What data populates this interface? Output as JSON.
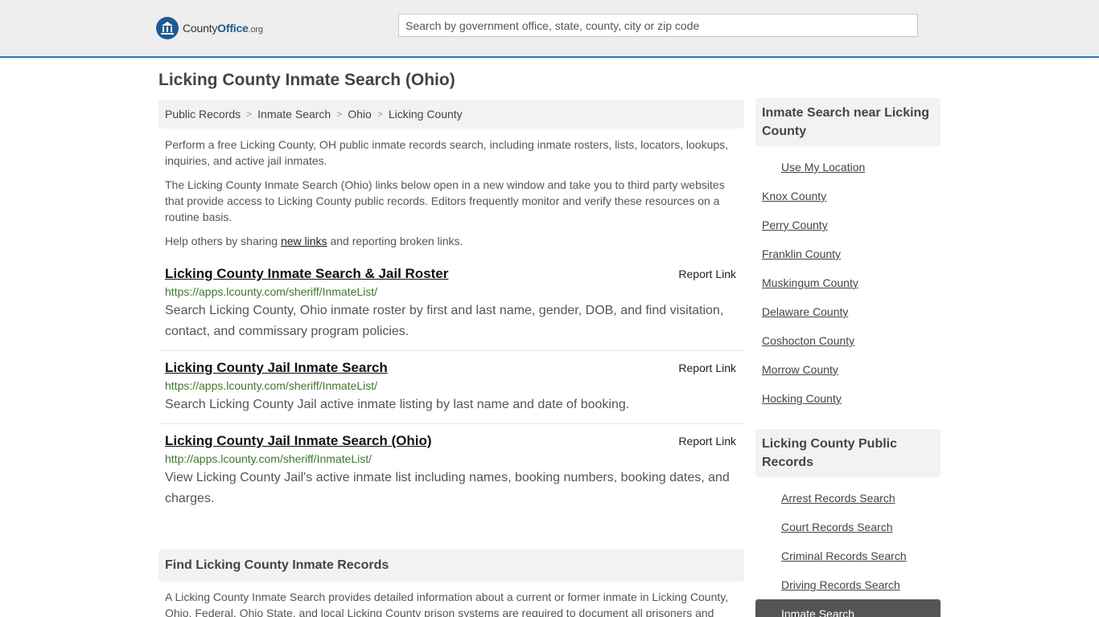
{
  "header": {
    "logo_main": "County",
    "logo_bold": "Office",
    "logo_tld": ".org",
    "search_placeholder": "Search by government office, state, county, city or zip code"
  },
  "page": {
    "title": "Licking County Inmate Search (Ohio)"
  },
  "breadcrumb": [
    "Public Records",
    "Inmate Search",
    "Ohio",
    "Licking County"
  ],
  "intro": {
    "p1": "Perform a free Licking County, OH public inmate records search, including inmate rosters, lists, locators, lookups, inquiries, and active jail inmates.",
    "p2": "The Licking County Inmate Search (Ohio) links below open in a new window and take you to third party websites that provide access to Licking County public records. Editors frequently monitor and verify these resources on a routine basis.",
    "p3_before": "Help others by sharing ",
    "p3_link": "new links",
    "p3_after": " and reporting broken links."
  },
  "results": [
    {
      "title": "Licking County Inmate Search & Jail Roster",
      "report": "Report Link",
      "url": "https://apps.lcounty.com/sheriff/InmateList/",
      "desc": "Search Licking County, Ohio inmate roster by first and last name, gender, DOB, and find visitation, contact, and commissary program policies."
    },
    {
      "title": "Licking County Jail Inmate Search",
      "report": "Report Link",
      "url": "https://apps.lcounty.com/sheriff/InmateList/",
      "desc": "Search Licking County Jail active inmate listing by last name and date of booking."
    },
    {
      "title": "Licking County Jail Inmate Search (Ohio)",
      "report": "Report Link",
      "url": "http://apps.lcounty.com/sheriff/InmateList/",
      "desc": "View Licking County Jail's active inmate list including names, booking numbers, booking dates, and charges."
    }
  ],
  "find_section": {
    "title": "Find Licking County Inmate Records",
    "text": "A Licking County Inmate Search provides detailed information about a current or former inmate in Licking County, Ohio. Federal, Ohio State, and local Licking County prison systems are required to document all prisoners and"
  },
  "sidebar": {
    "near_title": "Inmate Search near Licking County",
    "use_location": "Use My Location",
    "nearby": [
      "Knox County",
      "Perry County",
      "Franklin County",
      "Muskingum County",
      "Delaware County",
      "Coshocton County",
      "Morrow County",
      "Hocking County"
    ],
    "public_title": "Licking County Public Records",
    "public_records": [
      "Arrest Records Search",
      "Court Records Search",
      "Criminal Records Search",
      "Driving Records Search",
      "Inmate Search"
    ]
  },
  "colors": {
    "accent": "#2d76b5",
    "url_green": "#3a7a2a",
    "header_bg": "#eeeeee"
  }
}
